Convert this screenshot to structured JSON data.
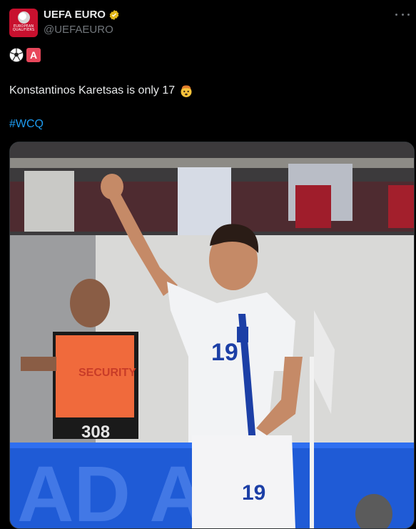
{
  "account": {
    "display_name": "UEFA EURO",
    "handle": "@UEFAEURO",
    "avatar_text": "EUROPEAN QUALIFIERS",
    "verified": true
  },
  "tweet": {
    "emoji_badge": "A",
    "text": "Konstantinos Karetsas is only 17",
    "hashtag": "#WCQ"
  },
  "media": {
    "description_texts": {
      "security_label": "SECURITY",
      "steward_number": "308",
      "player_number_chest": "19",
      "player_number_shorts": "19"
    }
  },
  "colors": {
    "background": "#000000",
    "link": "#1d9bf0",
    "secondary_text": "#71767b",
    "avatar_red": "#c8102e"
  },
  "icons": [
    "soccer-ball-icon",
    "a-button-icon",
    "exploding-head-icon",
    "verified-badge-icon",
    "more-options-icon"
  ]
}
